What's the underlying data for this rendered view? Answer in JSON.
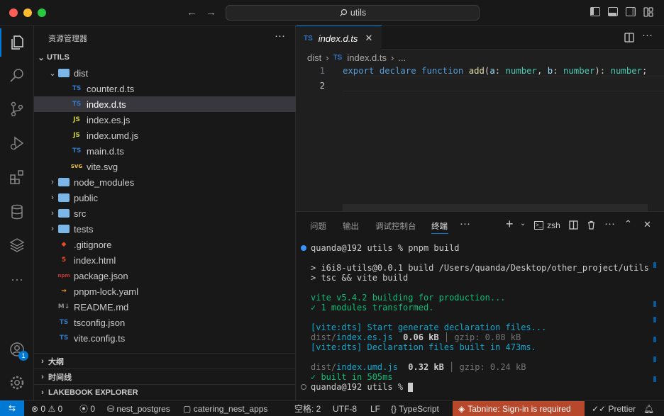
{
  "titlebar": {
    "search": "utils"
  },
  "sidebar": {
    "title": "资源管理器",
    "root": "UTILS",
    "items": [
      {
        "label": "dist",
        "icon": "folder-icon",
        "kind": "folder-open",
        "indent": 1
      },
      {
        "label": "counter.d.ts",
        "icon": "TS",
        "kind": "ts",
        "indent": 2
      },
      {
        "label": "index.d.ts",
        "icon": "TS",
        "kind": "ts",
        "indent": 2,
        "selected": true
      },
      {
        "label": "index.es.js",
        "icon": "JS",
        "kind": "js",
        "indent": 2
      },
      {
        "label": "index.umd.js",
        "icon": "JS",
        "kind": "js",
        "indent": 2
      },
      {
        "label": "main.d.ts",
        "icon": "TS",
        "kind": "ts",
        "indent": 2
      },
      {
        "label": "vite.svg",
        "icon": "SVG",
        "kind": "svg",
        "indent": 2
      },
      {
        "label": "node_modules",
        "icon": "folder-icon",
        "kind": "folder",
        "indent": 1
      },
      {
        "label": "public",
        "icon": "folder-icon",
        "kind": "folder",
        "indent": 1
      },
      {
        "label": "src",
        "icon": "folder-icon",
        "kind": "folder",
        "indent": 1
      },
      {
        "label": "tests",
        "icon": "folder-icon",
        "kind": "folder",
        "indent": 1
      },
      {
        "label": ".gitignore",
        "icon": "git-icon",
        "kind": "git",
        "indent": 1
      },
      {
        "label": "index.html",
        "icon": "html-icon",
        "kind": "html",
        "indent": 1
      },
      {
        "label": "package.json",
        "icon": "npm-icon",
        "kind": "npm",
        "indent": 1
      },
      {
        "label": "pnpm-lock.yaml",
        "icon": "pnpm-icon",
        "kind": "yaml",
        "indent": 1
      },
      {
        "label": "README.md",
        "icon": "M↓",
        "kind": "md",
        "indent": 1
      },
      {
        "label": "tsconfig.json",
        "icon": "TS",
        "kind": "tsconfig",
        "indent": 1
      },
      {
        "label": "vite.config.ts",
        "icon": "TS",
        "kind": "ts",
        "indent": 1
      }
    ],
    "sections": [
      "大纲",
      "时间线",
      "LAKEBOOK EXPLORER"
    ]
  },
  "editor": {
    "tab": "index.d.ts",
    "tab_icon": "TS",
    "breadcrumb": [
      "dist",
      "index.d.ts",
      "..."
    ],
    "lines": [
      "1",
      "2"
    ]
  },
  "panel": {
    "tabs": [
      "问题",
      "输出",
      "调试控制台",
      "终端"
    ],
    "shell": "zsh",
    "terminal": [
      "quanda@192 utils % pnpm build",
      "",
      "> i6i8-utils@0.0.1 build /Users/quanda/Desktop/other_project/utils",
      "> tsc && vite build",
      "",
      "vite v5.4.2 building for production...",
      "✓ 1 modules transformed.",
      "",
      "[vite:dts] Start generate declaration files...",
      "dist/index.es.js  0.06 kB │ gzip: 0.08 kB",
      "[vite:dts] Declaration files built in 473ms.",
      "",
      "dist/index.umd.js  0.32 kB │ gzip: 0.24 kB",
      "✓ built in 505ms",
      "quanda@192 utils % "
    ]
  },
  "statusbar": {
    "errors": "0",
    "warnings": "0",
    "ports": "0",
    "db": "nest_postgres",
    "project": "catering_nest_apps",
    "spaces": "空格: 2",
    "encoding": "UTF-8",
    "eol": "LF",
    "lang": "TypeScript",
    "tabnine": "Tabnine: Sign-in is required",
    "prettier": "Prettier"
  },
  "badges": {
    "accounts": "1"
  },
  "colors": {
    "accent": "#0078d4",
    "ts": "#3178c6",
    "js": "#cbcb41",
    "tabnine": "#b8482b"
  }
}
